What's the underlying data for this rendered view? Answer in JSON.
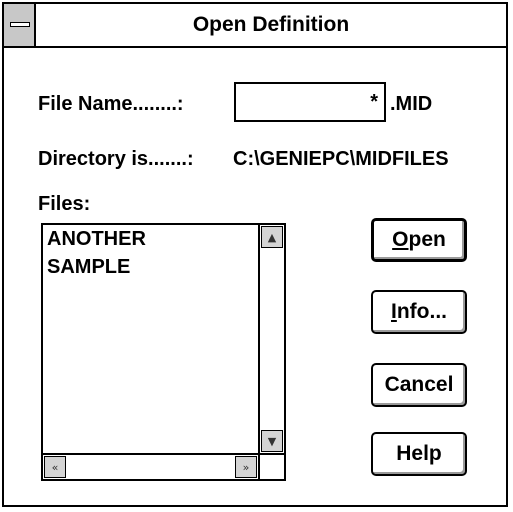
{
  "window": {
    "title": "Open Definition"
  },
  "form": {
    "file_name_label": "File Name........:",
    "file_name_value": "*",
    "extension": ".MID",
    "directory_label": "Directory is.......:",
    "directory_value": "C:\\GENIEPC\\MIDFILES",
    "files_label": "Files:"
  },
  "files": {
    "items": [
      "ANOTHER",
      "SAMPLE"
    ]
  },
  "scroll_icons": {
    "up": "scroll-up-arrow",
    "down": "scroll-down-arrow",
    "left": "scroll-left-arrow",
    "right": "scroll-right-arrow"
  },
  "buttons": {
    "open": {
      "mnemonic": "O",
      "rest": "pen"
    },
    "info": {
      "mnemonic": "I",
      "rest": "nfo..."
    },
    "cancel": {
      "label": "Cancel"
    },
    "help": {
      "label": "Help"
    }
  }
}
